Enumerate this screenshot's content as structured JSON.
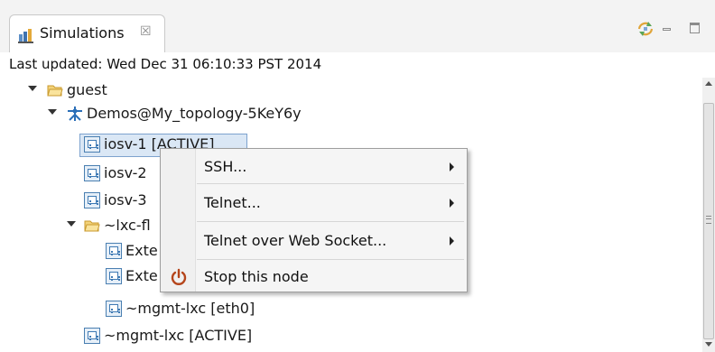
{
  "tab": {
    "title": "Simulations",
    "close_glyph": "☒",
    "icon": "simulations-icon"
  },
  "toolbar": {
    "icons": [
      "sync-icon",
      "minimize-icon",
      "maximize-icon"
    ]
  },
  "status": {
    "text": "Last updated: Wed Dec 31 06:10:33 PST 2014"
  },
  "tree": {
    "nodes": [
      {
        "label": "guest",
        "icon": "folder-open-icon",
        "expanded": true
      },
      {
        "label": "Demos@My_topology-5KeY6y",
        "icon": "topology-icon",
        "expanded": true
      },
      {
        "label": "iosv-1  [ACTIVE]",
        "icon": "router-node-icon",
        "selected": true
      },
      {
        "label": "iosv-2",
        "icon": "router-node-icon"
      },
      {
        "label": "iosv-3",
        "icon": "router-node-icon"
      },
      {
        "label": "~lxc-fl",
        "icon": "folder-open-icon",
        "expanded": true
      },
      {
        "label": "Exte",
        "icon": "router-node-icon"
      },
      {
        "label": "Exte",
        "icon": "router-node-icon"
      },
      {
        "label": "~mgmt-lxc  [eth0]",
        "icon": "router-node-icon"
      },
      {
        "label": "~mgmt-lxc  [ACTIVE]",
        "icon": "router-node-icon"
      }
    ]
  },
  "context_menu": {
    "items": [
      {
        "label": "SSH...",
        "submenu": true
      },
      {
        "label": "Telnet...",
        "submenu": true
      },
      {
        "label": "Telnet over Web Socket...",
        "submenu": true
      },
      {
        "label": "Stop this node",
        "submenu": false,
        "icon": "power-icon"
      }
    ]
  },
  "colors": {
    "accent_folder": "#e7b43a",
    "topology": "#2b6fb8",
    "selection": "#dae7f5",
    "power": "#b5451b"
  }
}
